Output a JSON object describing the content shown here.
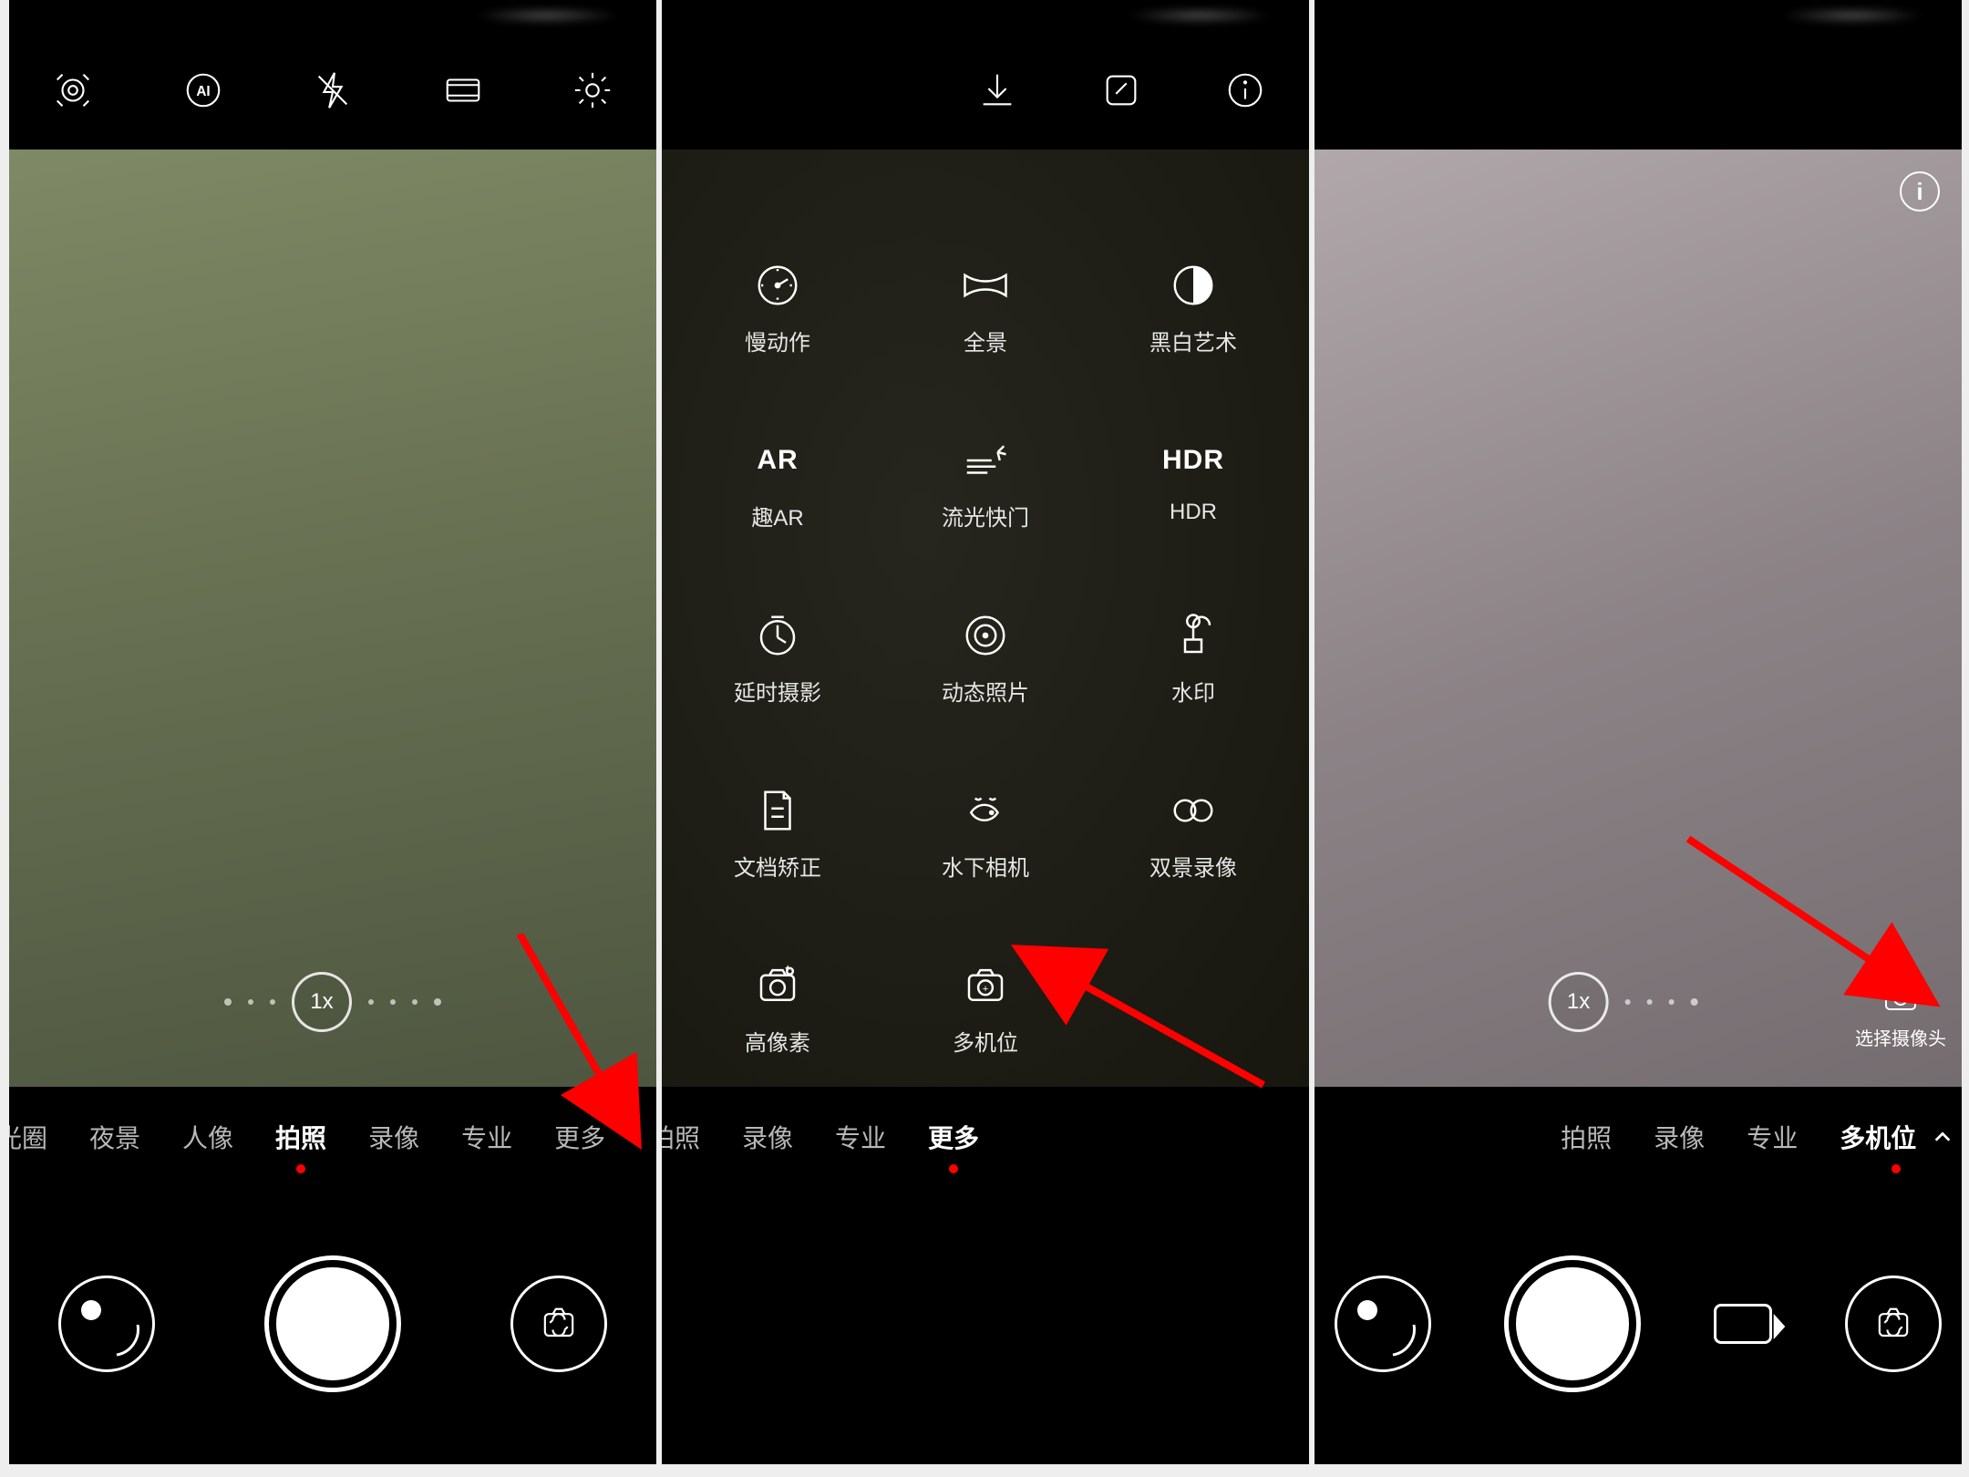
{
  "accent_color": "#ff0000",
  "zoom": {
    "label": "1x"
  },
  "panel1": {
    "top_icons": [
      "lens-icon",
      "ai-icon",
      "flash-off-icon",
      "aspect-ratio-icon",
      "settings-gear-icon"
    ],
    "modes": {
      "items": [
        "光圈",
        "夜景",
        "人像",
        "拍照",
        "录像",
        "专业",
        "更多"
      ],
      "active_index": 3
    }
  },
  "panel2": {
    "top_icons": [
      "download-icon",
      "edit-icon",
      "info-icon"
    ],
    "grid": [
      {
        "id": "slow-motion",
        "label": "慢动作",
        "icon": "slow-motion-icon"
      },
      {
        "id": "panorama",
        "label": "全景",
        "icon": "panorama-icon"
      },
      {
        "id": "monochrome",
        "label": "黑白艺术",
        "icon": "half-circle-icon"
      },
      {
        "id": "fun-ar",
        "label": "趣AR",
        "icon": "text:AR"
      },
      {
        "id": "light-painting",
        "label": "流光快门",
        "icon": "light-trails-icon"
      },
      {
        "id": "hdr",
        "label": "HDR",
        "icon": "text:HDR"
      },
      {
        "id": "time-lapse",
        "label": "延时摄影",
        "icon": "clock-icon"
      },
      {
        "id": "motion-photo",
        "label": "动态照片",
        "icon": "target-icon"
      },
      {
        "id": "watermark",
        "label": "水印",
        "icon": "stamp-icon"
      },
      {
        "id": "doc-scan",
        "label": "文档矫正",
        "icon": "document-icon"
      },
      {
        "id": "underwater",
        "label": "水下相机",
        "icon": "fish-icon"
      },
      {
        "id": "dual-view",
        "label": "双景录像",
        "icon": "dual-lens-icon"
      },
      {
        "id": "high-res",
        "label": "高像素",
        "icon": "high-res-icon"
      },
      {
        "id": "multi-cam",
        "label": "多机位",
        "icon": "multi-cam-icon"
      }
    ],
    "modes": {
      "items": [
        "拍照",
        "录像",
        "专业",
        "更多"
      ],
      "active_index": 3
    }
  },
  "panel3": {
    "select_camera_label": "选择摄像头",
    "modes": {
      "items": [
        "拍照",
        "录像",
        "专业",
        "多机位"
      ],
      "active_index": 3,
      "show_chevron_on_active": true
    }
  }
}
